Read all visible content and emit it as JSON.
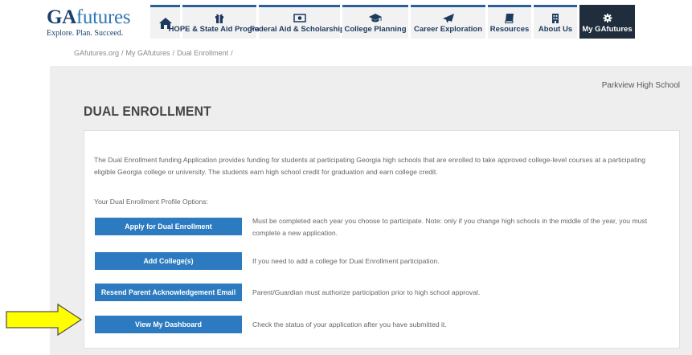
{
  "logo": {
    "main_part1": "GA",
    "main_part2": "futures",
    "tagline": "Explore. Plan. Succeed."
  },
  "nav": {
    "home_icon": "home-icon",
    "items": [
      {
        "label": "HOPE & State Aid Programs",
        "icon": "gift-icon"
      },
      {
        "label": "Federal Aid & Scholarships",
        "icon": "money-icon"
      },
      {
        "label": "College Planning",
        "icon": "graduation-cap-icon"
      },
      {
        "label": "Career Exploration",
        "icon": "paper-plane-icon"
      },
      {
        "label": "Resources",
        "icon": "book-icon"
      },
      {
        "label": "About Us",
        "icon": "building-icon"
      },
      {
        "label": "My GAfutures",
        "icon": "gear-icon",
        "active": true
      }
    ]
  },
  "breadcrumb": {
    "items": [
      "GAfutures.org",
      "My GAfutures",
      "Dual Enrollment"
    ]
  },
  "school_name": "Parkview High School",
  "page_title": "DUAL ENROLLMENT",
  "intro_text": "The Dual Enrollment funding Application provides funding for students at participating Georgia high schools that are enrolled to take approved college-level courses at a participating eligible Georgia college or university. The students earn high school credit for graduation and earn college credit.",
  "options_label": "Your Dual Enrollment Profile Options:",
  "options": [
    {
      "button": "Apply for Dual Enrollment",
      "description": "Must be completed each year you choose to participate. Note: only if you change high schools in the middle of the year, you must complete a new application."
    },
    {
      "button": "Add College(s)",
      "description": "If you need to add a college for Dual Enrollment participation."
    },
    {
      "button": "Resend Parent Acknowledgement Email",
      "description": "Parent/Guardian must authorize participation prior to high school approval."
    },
    {
      "button": "View My Dashboard",
      "description": "Check the status of your application after you have submitted it."
    }
  ],
  "colors": {
    "nav_top_border": "#2a5f9a",
    "nav_active_bg": "#1f2d3d",
    "button_blue": "#2c7abf",
    "panel_bg": "#eeeeee",
    "arrow_yellow": "#ffff00"
  }
}
